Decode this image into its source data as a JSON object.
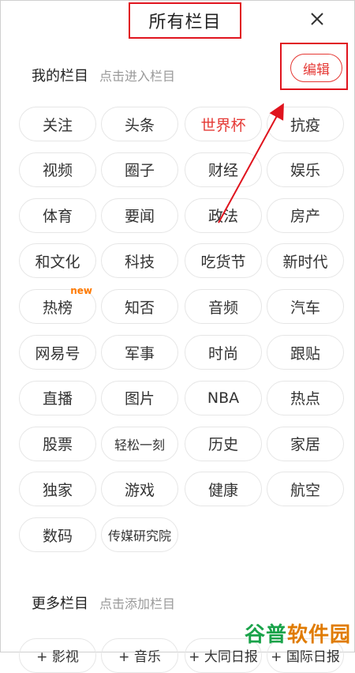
{
  "header": {
    "title": "所有栏目"
  },
  "my_channels": {
    "title": "我的栏目",
    "hint": "点击进入栏目",
    "edit_label": "编辑",
    "items": [
      {
        "label": "关注"
      },
      {
        "label": "头条"
      },
      {
        "label": "世界杯",
        "active": true
      },
      {
        "label": "抗疫"
      },
      {
        "label": "视频"
      },
      {
        "label": "圈子"
      },
      {
        "label": "财经"
      },
      {
        "label": "娱乐"
      },
      {
        "label": "体育"
      },
      {
        "label": "要闻"
      },
      {
        "label": "政法"
      },
      {
        "label": "房产"
      },
      {
        "label": "和文化"
      },
      {
        "label": "科技"
      },
      {
        "label": "吃货节"
      },
      {
        "label": "新时代"
      },
      {
        "label": "热榜",
        "badge": "new"
      },
      {
        "label": "知否"
      },
      {
        "label": "音频"
      },
      {
        "label": "汽车"
      },
      {
        "label": "网易号"
      },
      {
        "label": "军事"
      },
      {
        "label": "时尚"
      },
      {
        "label": "跟贴"
      },
      {
        "label": "直播"
      },
      {
        "label": "图片"
      },
      {
        "label": "NBA"
      },
      {
        "label": "热点"
      },
      {
        "label": "股票"
      },
      {
        "label": "轻松一刻"
      },
      {
        "label": "历史"
      },
      {
        "label": "家居"
      },
      {
        "label": "独家"
      },
      {
        "label": "游戏"
      },
      {
        "label": "健康"
      },
      {
        "label": "航空"
      },
      {
        "label": "数码"
      },
      {
        "label": "传媒研究院"
      }
    ]
  },
  "more_channels": {
    "title": "更多栏目",
    "hint": "点击添加栏目",
    "partial_items": [
      "+ 影视",
      "+ 音乐",
      "+ 大同日报",
      "+ 国际日报"
    ]
  },
  "watermark": {
    "part1": "谷普",
    "part2": "软件园"
  },
  "colors": {
    "accent": "#e53935",
    "highlight_box": "#e0141e",
    "arrow": "#e0141e"
  }
}
